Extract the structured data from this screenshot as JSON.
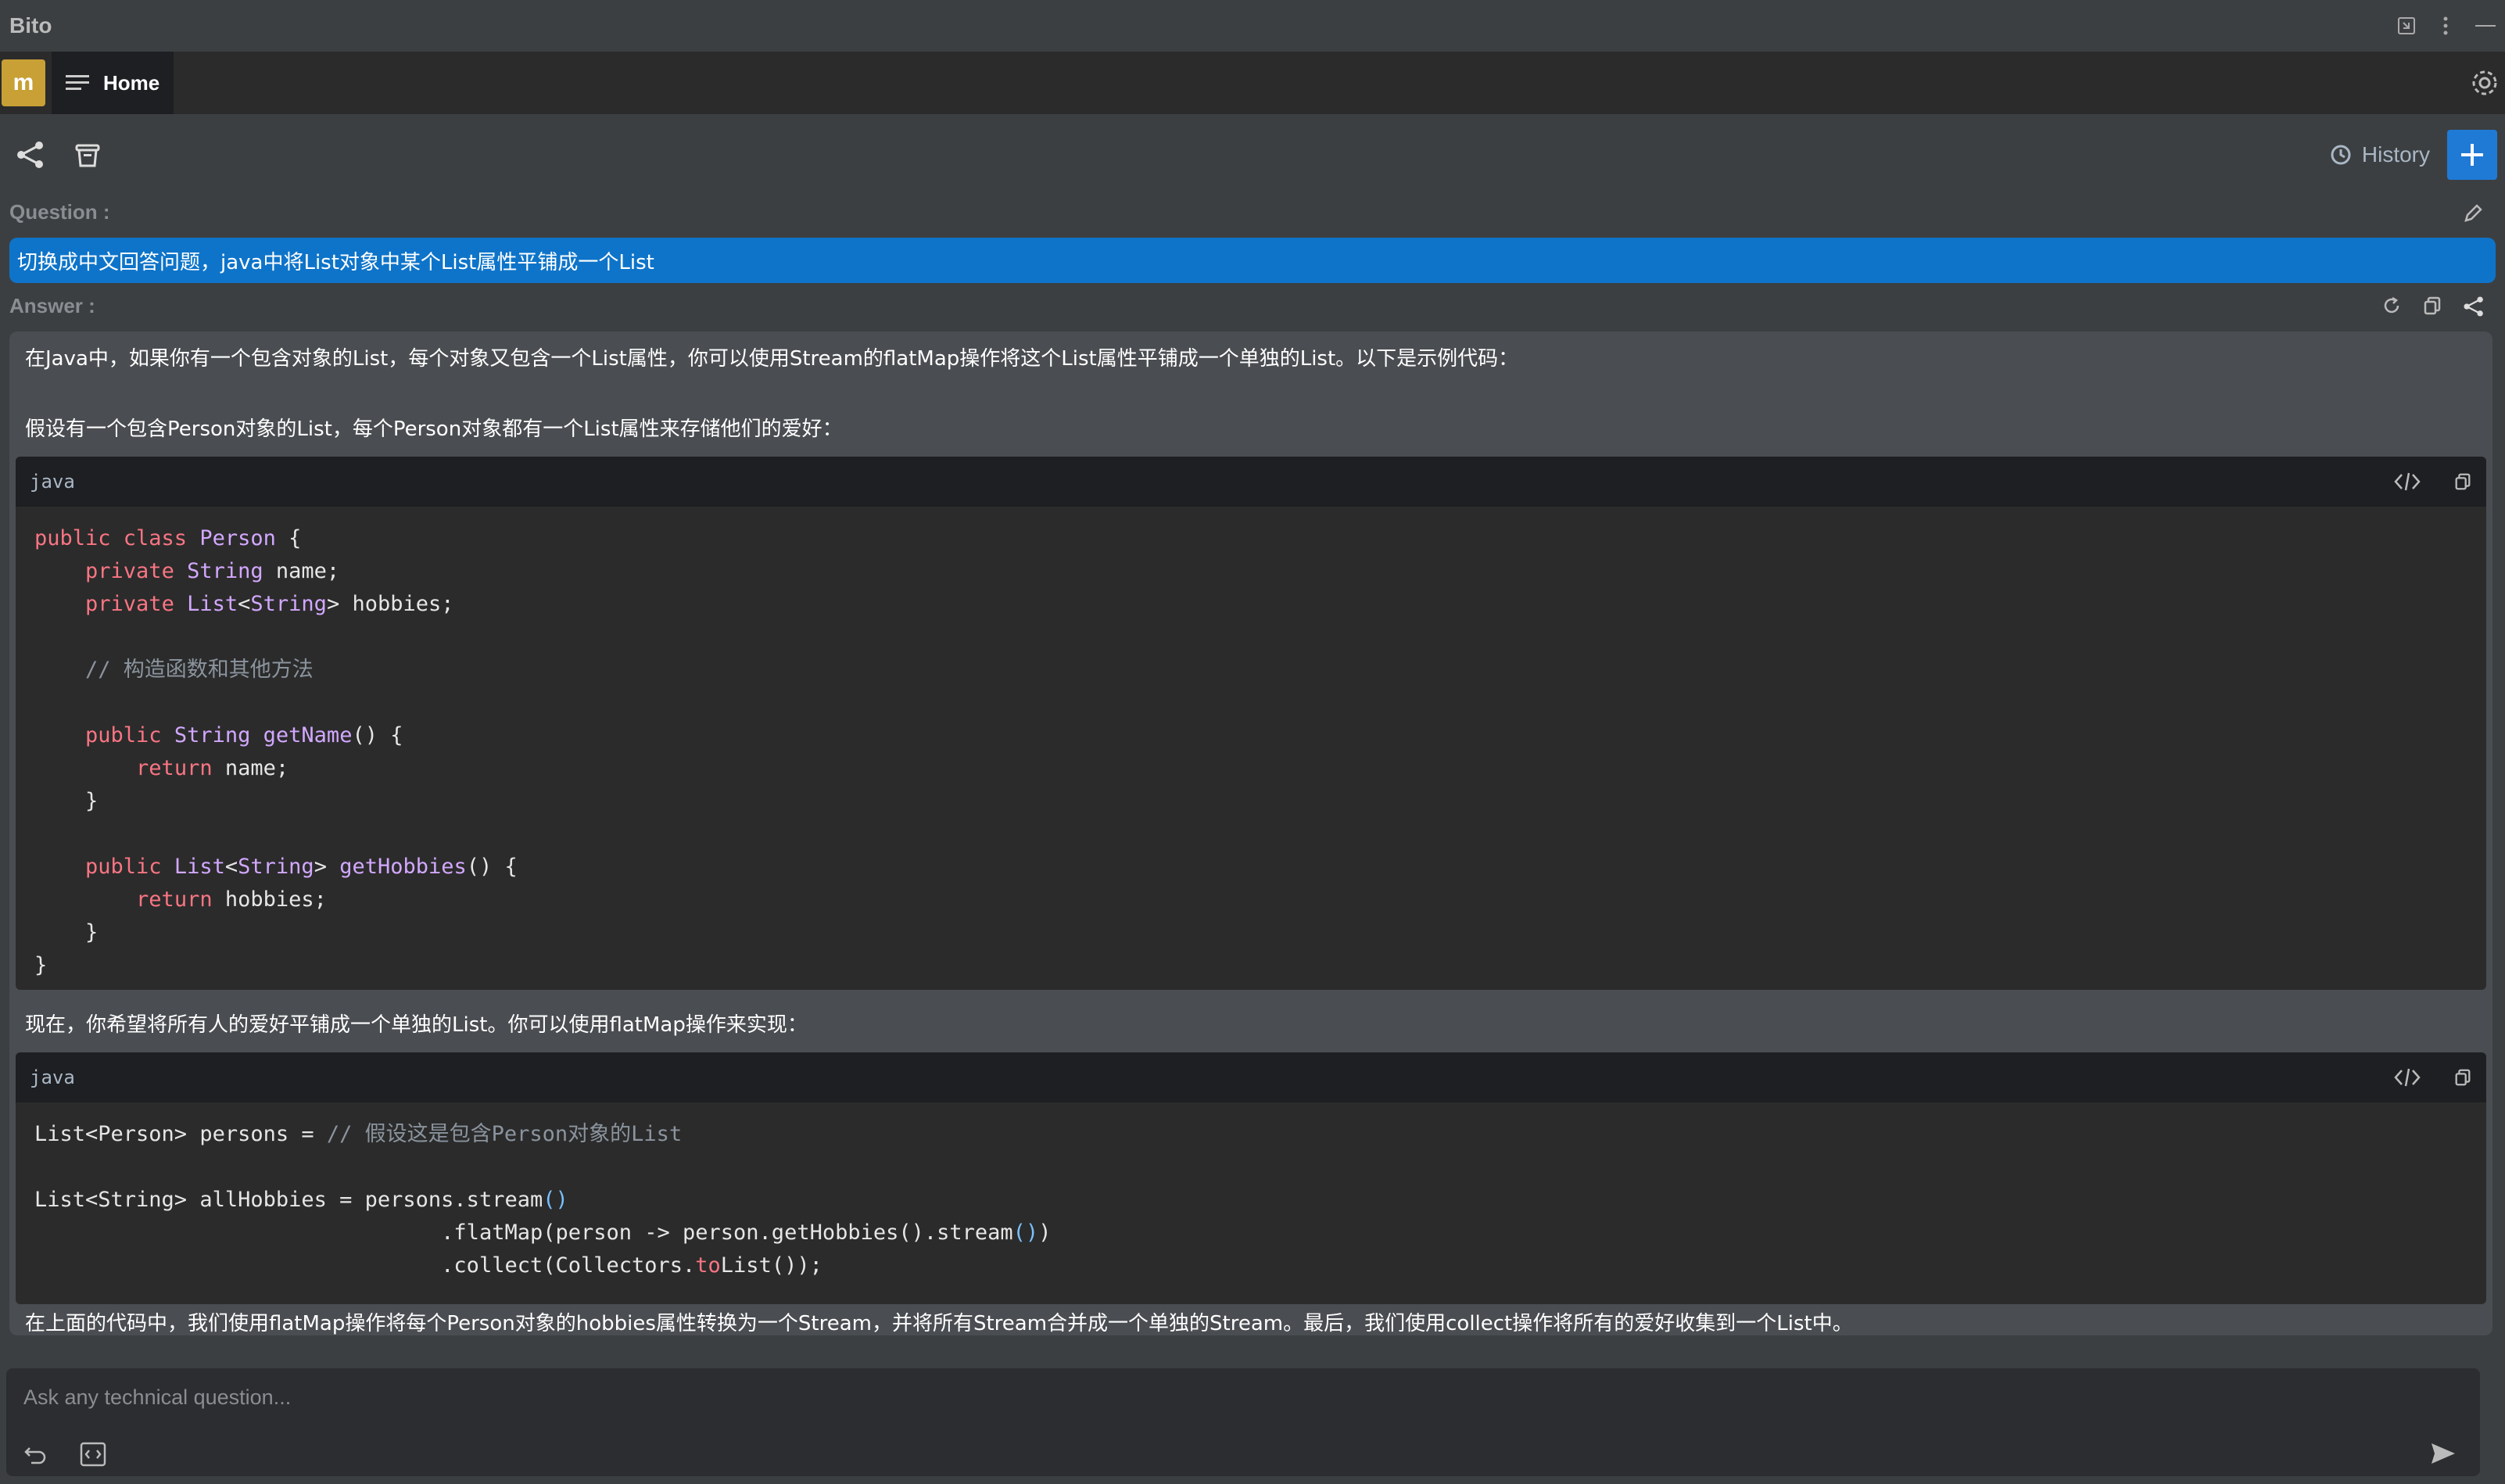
{
  "app": {
    "title": "Bito"
  },
  "tabs": {
    "avatar_initial": "m",
    "home_label": "Home"
  },
  "toolbar": {
    "history_label": "History"
  },
  "question": {
    "label": "Question :",
    "text": "切换成中文回答问题，java中将List对象中某个List属性平铺成一个List"
  },
  "answer": {
    "label": "Answer :",
    "para1": "在Java中，如果你有一个包含对象的List，每个对象又包含一个List属性，你可以使用Stream的flatMap操作将这个List属性平铺成一个单独的List。以下是示例代码：",
    "para2": "假设有一个包含Person对象的List，每个Person对象都有一个List属性来存储他们的爱好：",
    "para3": "现在，你希望将所有人的爱好平铺成一个单独的List。你可以使用flatMap操作来实现：",
    "para4": "在上面的代码中，我们使用flatMap操作将每个Person对象的hobbies属性转换为一个Stream，并将所有Stream合并成一个单独的Stream。最后，我们使用collect操作将所有的爱好收集到一个List中。",
    "code_blocks": [
      {
        "language": "java",
        "lines": [
          "public class Person {",
          "    private String name;",
          "    private List<String> hobbies;",
          "",
          "    // 构造函数和其他方法",
          "",
          "    public String getName() {",
          "        return name;",
          "    }",
          "",
          "    public List<String> getHobbies() {",
          "        return hobbies;",
          "    }",
          "}"
        ]
      },
      {
        "language": "java",
        "lines": [
          "List<Person> persons = // 假设这是包含Person对象的List",
          "",
          "List<String> allHobbies = persons.stream()",
          "                                .flatMap(person -> person.getHobbies().stream())",
          "                                .collect(Collectors.toList());"
        ]
      }
    ]
  },
  "input": {
    "placeholder": "Ask any technical question..."
  }
}
